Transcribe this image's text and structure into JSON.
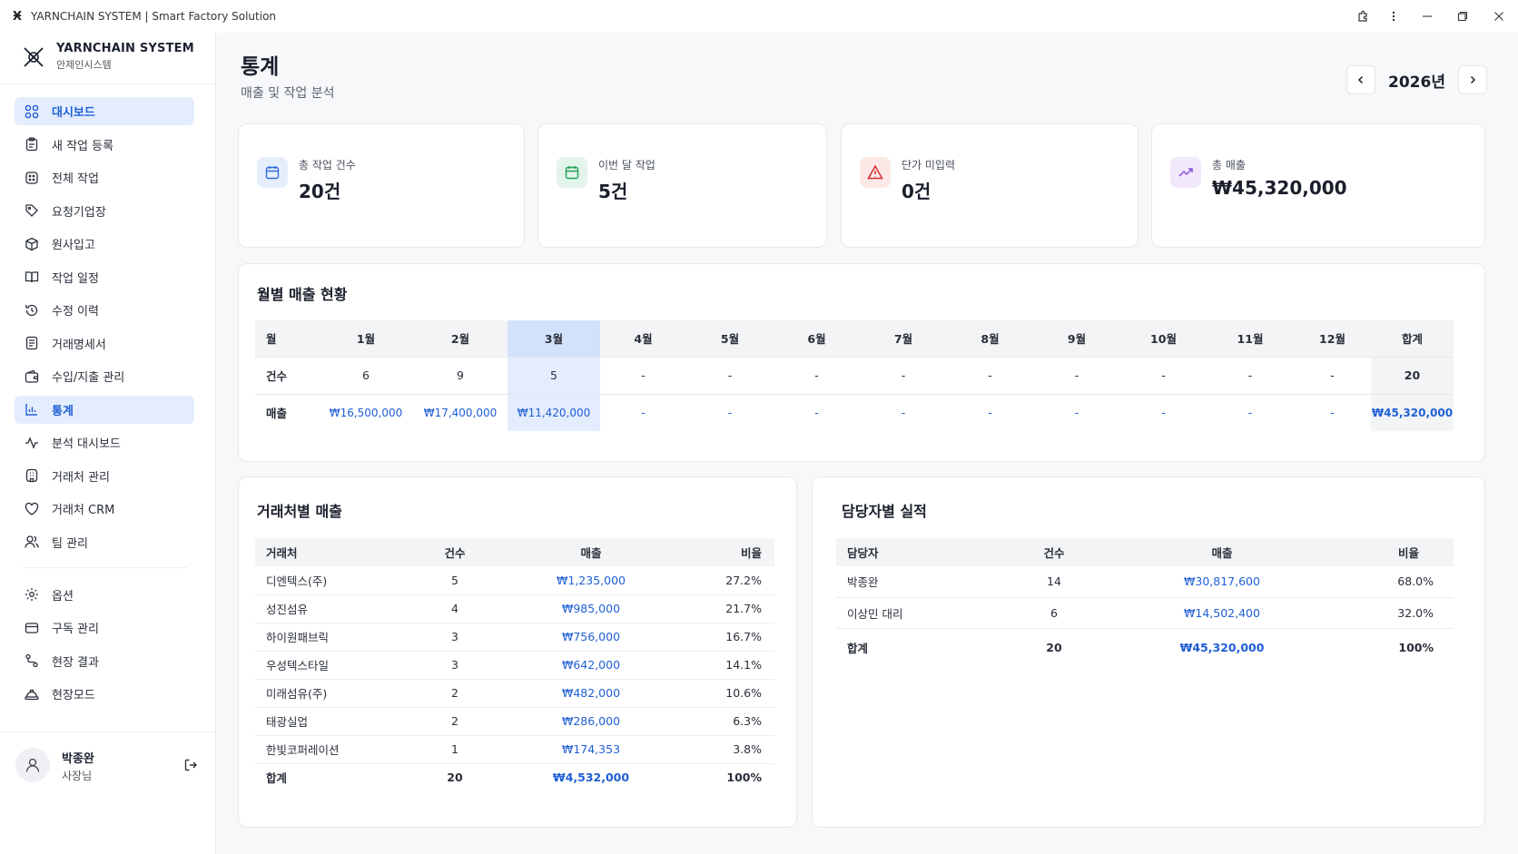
{
  "window": {
    "title": "YARNCHAIN SYSTEM | Smart Factory Solution",
    "logo_glyph": "Ӿ"
  },
  "brand": {
    "name": "YARNCHAIN SYSTEM",
    "sub": "안제인시스템"
  },
  "sidebar": {
    "items": [
      {
        "label": "대시보드",
        "icon": "grid-icon",
        "active": true
      },
      {
        "label": "새 작업 등록",
        "icon": "clipboard-icon"
      },
      {
        "label": "전체 작업",
        "icon": "list-icon"
      },
      {
        "label": "요청기업장",
        "icon": "tag-icon"
      },
      {
        "label": "원사입고",
        "icon": "box-icon"
      },
      {
        "label": "작업 일정",
        "icon": "book-icon"
      },
      {
        "label": "수정 이력",
        "icon": "history-icon"
      },
      {
        "label": "거래명세서",
        "icon": "document-icon"
      },
      {
        "label": "수입/지출 관리",
        "icon": "wallet-icon"
      },
      {
        "label": "통계",
        "icon": "chart-icon",
        "active": true
      },
      {
        "label": "분석 대시보드",
        "icon": "activity-icon"
      },
      {
        "label": "거래처 관리",
        "icon": "building-icon"
      },
      {
        "label": "거래처 CRM",
        "icon": "heart-icon"
      },
      {
        "label": "팀 관리",
        "icon": "users-icon"
      }
    ],
    "bottom_items": [
      {
        "label": "옵션",
        "icon": "gear-icon"
      },
      {
        "label": "구독 관리",
        "icon": "card-icon"
      },
      {
        "label": "현장 결과",
        "icon": "route-icon"
      },
      {
        "label": "현장모드",
        "icon": "hardhat-icon"
      }
    ],
    "user": {
      "name": "박종완",
      "role": "사장님"
    }
  },
  "header": {
    "title": "통계",
    "subtitle": "매출 및 작업 분석",
    "year": "2026년"
  },
  "stats": [
    {
      "label": "총 작업 건수",
      "value": "20건",
      "icon": "calendar-icon",
      "color": "#2f6fd8",
      "bg": "#e6eefc"
    },
    {
      "label": "이번 달 작업",
      "value": "5건",
      "icon": "calendar-check-icon",
      "color": "#22a05a",
      "bg": "#e3f5ea"
    },
    {
      "label": "단가 미입력",
      "value": "0건",
      "icon": "warning-icon",
      "color": "#d43030",
      "bg": "#fde8e8"
    },
    {
      "label": "총 매출",
      "value": "₩45,320,000",
      "icon": "trending-up-icon",
      "color": "#8a4fd8",
      "bg": "#f1e8fc"
    }
  ],
  "monthly": {
    "title": "월별 매출 현황",
    "headers": [
      "월",
      "1월",
      "2월",
      "3월",
      "4월",
      "5월",
      "6월",
      "7월",
      "8월",
      "9월",
      "10월",
      "11월",
      "12월",
      "합계"
    ],
    "count_label": "건수",
    "counts": [
      "6",
      "9",
      "5",
      "-",
      "-",
      "-",
      "-",
      "-",
      "-",
      "-",
      "-",
      "-",
      "20"
    ],
    "sales_label": "매출",
    "sales": [
      "₩16,500,000",
      "₩17,400,000",
      "₩11,420,000",
      "-",
      "-",
      "-",
      "-",
      "-",
      "-",
      "-",
      "-",
      "-",
      "₩45,320,000"
    ]
  },
  "clients": {
    "title": "거래처별 매출",
    "headers": [
      "거래처",
      "건수",
      "매출",
      "비율"
    ],
    "rows": [
      [
        "디엔텍스(주)",
        "5",
        "₩1,235,000",
        "27.2%"
      ],
      [
        "성진섬유",
        "4",
        "₩985,000",
        "21.7%"
      ],
      [
        "하이원패브릭",
        "3",
        "₩756,000",
        "16.7%"
      ],
      [
        "우성텍스타일",
        "3",
        "₩642,000",
        "14.1%"
      ],
      [
        "미래섬유(주)",
        "2",
        "₩482,000",
        "10.6%"
      ],
      [
        "태광실업",
        "2",
        "₩286,000",
        "6.3%"
      ],
      [
        "한빛코퍼레이션",
        "1",
        "₩174,353",
        "3.8%"
      ]
    ],
    "total": [
      "합계",
      "20",
      "₩4,532,000",
      "100%"
    ]
  },
  "managers": {
    "title": "담당자별 실적",
    "headers": [
      "담당자",
      "건수",
      "매출",
      "비율"
    ],
    "rows": [
      [
        "박종완",
        "14",
        "₩30,817,600",
        "68.0%"
      ],
      [
        "이상민 대리",
        "6",
        "₩14,502,400",
        "32.0%"
      ]
    ],
    "total": [
      "합계",
      "20",
      "₩45,320,000",
      "100%"
    ]
  }
}
